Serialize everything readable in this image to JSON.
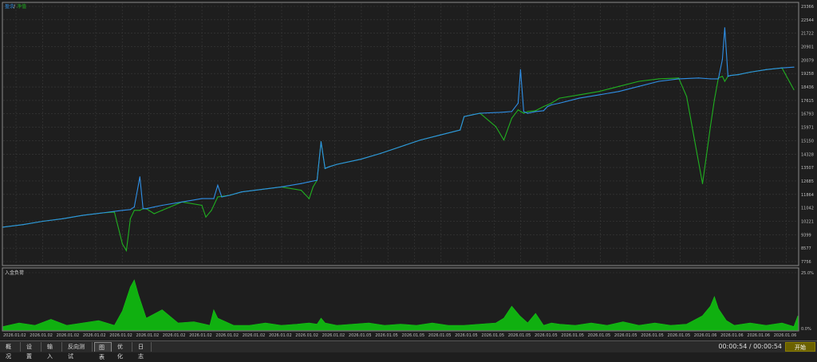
{
  "main_chart": {
    "legend": {
      "series_a": "盈余",
      "separator": "/",
      "series_b": "净值"
    },
    "y_ticks": [
      "23366",
      "22544",
      "21722",
      "20901",
      "20079",
      "19258",
      "18436",
      "17615",
      "16793",
      "15971",
      "15150",
      "14328",
      "13507",
      "12685",
      "11864",
      "11042",
      "10221",
      "9399",
      "8577",
      "7756"
    ],
    "x_ticks": [
      "2026.01.02",
      "2026.01.02",
      "2026.01.02",
      "2026.01.02",
      "2026.01.02",
      "2026.01.02",
      "2026.01.02",
      "2026.01.02",
      "2026.01.02",
      "2026.01.02",
      "2026.01.02",
      "2026.01.02",
      "2026.01.02",
      "2026.01.05",
      "2026.01.05",
      "2026.01.05",
      "2026.01.05",
      "2026.01.05",
      "2026.01.05",
      "2026.01.05",
      "2026.01.05",
      "2026.01.05",
      "2026.01.05",
      "2026.01.05",
      "2026.01.05",
      "2026.01.05",
      "2026.01.06",
      "2026.01.06",
      "2026.01.06",
      "2026.01.06"
    ],
    "colors": {
      "balance": "#2f8fe6",
      "equity": "#20b020",
      "grid": "#3a3a3a",
      "text": "#bfbfbf"
    }
  },
  "sub_chart": {
    "label": "入金负荷",
    "y_ticks": [
      "25.0%",
      "0.0%"
    ],
    "color": "#10b010"
  },
  "chart_data": [
    {
      "type": "line",
      "title": "",
      "ylim": [
        7756,
        23366
      ],
      "series": [
        {
          "name": "盈余",
          "color": "#2f8fe6",
          "x": [
            0,
            25,
            50,
            75,
            100,
            125,
            150,
            160,
            165,
            172,
            176,
            180,
            190,
            200,
            225,
            250,
            265,
            270,
            275,
            285,
            300,
            325,
            350,
            375,
            385,
            395,
            400,
            405,
            410,
            420,
            450,
            475,
            500,
            525,
            550,
            575,
            580,
            590,
            600,
            625,
            640,
            648,
            651,
            655,
            660,
            670,
            680,
            685,
            690,
            700,
            725,
            750,
            775,
            800,
            825,
            850,
            875,
            890,
            900,
            905,
            908,
            912,
            915,
            925,
            940,
            960,
            980,
            995
          ],
          "y": [
            10000,
            10150,
            10350,
            10500,
            10700,
            10850,
            11000,
            11050,
            11200,
            13000,
            11100,
            11100,
            11200,
            11300,
            11500,
            11700,
            11700,
            12500,
            11800,
            11900,
            12100,
            12250,
            12400,
            12600,
            12700,
            12800,
            15100,
            13500,
            13600,
            13750,
            14050,
            14400,
            14800,
            15200,
            15500,
            15800,
            16600,
            16700,
            16800,
            16850,
            16900,
            17400,
            19400,
            16900,
            16800,
            16900,
            16950,
            17200,
            17300,
            17400,
            17700,
            17900,
            18100,
            18400,
            18700,
            18850,
            18900,
            18850,
            18850,
            20000,
            21900,
            19000,
            19050,
            19100,
            19250,
            19400,
            19500,
            19550
          ]
        },
        {
          "name": "净值",
          "color": "#20b020",
          "x": [
            0,
            25,
            50,
            75,
            100,
            125,
            140,
            150,
            155,
            160,
            165,
            172,
            176,
            180,
            190,
            200,
            225,
            250,
            255,
            262,
            270,
            285,
            300,
            325,
            350,
            375,
            385,
            390,
            395,
            400,
            405,
            410,
            420,
            450,
            475,
            500,
            525,
            550,
            575,
            580,
            590,
            600,
            620,
            630,
            640,
            648,
            655,
            660,
            670,
            680,
            685,
            690,
            700,
            725,
            750,
            775,
            800,
            825,
            850,
            860,
            870,
            880,
            885,
            890,
            895,
            900,
            905,
            908,
            912,
            915,
            925,
            940,
            960,
            980,
            995
          ],
          "y": [
            10000,
            10150,
            10350,
            10500,
            10700,
            10850,
            10900,
            9000,
            8600,
            10500,
            11000,
            11000,
            11100,
            11100,
            10800,
            11000,
            11500,
            11300,
            10600,
            11000,
            11800,
            11900,
            12100,
            12250,
            12400,
            12200,
            11700,
            12400,
            12800,
            15100,
            13500,
            13600,
            13750,
            14050,
            14400,
            14800,
            15200,
            15500,
            15800,
            16600,
            16700,
            16800,
            16000,
            15200,
            16500,
            17000,
            16800,
            16900,
            16950,
            17200,
            17300,
            17400,
            17700,
            17900,
            18100,
            18400,
            18700,
            18850,
            18900,
            17800,
            15200,
            12600,
            14300,
            16000,
            17600,
            18900,
            19000,
            18700,
            19000,
            19050,
            19100,
            19250,
            19400,
            19500,
            18200
          ]
        }
      ]
    },
    {
      "type": "area",
      "title": "入金负荷",
      "ylim": [
        0,
        25
      ],
      "series": [
        {
          "name": "入金负荷",
          "x": [
            0,
            20,
            40,
            60,
            80,
            100,
            120,
            140,
            150,
            160,
            165,
            170,
            180,
            200,
            220,
            240,
            260,
            265,
            270,
            290,
            310,
            330,
            350,
            370,
            385,
            395,
            400,
            405,
            420,
            440,
            460,
            480,
            500,
            520,
            540,
            560,
            580,
            600,
            620,
            630,
            640,
            650,
            660,
            670,
            680,
            690,
            700,
            720,
            740,
            760,
            780,
            800,
            820,
            840,
            860,
            880,
            890,
            895,
            900,
            910,
            920,
            940,
            960,
            980,
            995,
            1000
          ],
          "y": [
            1.5,
            3,
            2,
            4.5,
            2,
            3,
            4,
            2,
            8,
            18,
            21,
            15,
            5,
            8.5,
            3,
            3.5,
            2,
            8.5,
            5,
            2,
            2,
            3,
            2,
            2.5,
            3,
            2.5,
            5,
            3,
            2,
            2.5,
            3,
            2,
            2.5,
            2,
            3,
            2,
            2,
            2.5,
            3,
            5,
            10,
            6,
            3,
            7,
            2,
            3,
            2.5,
            2,
            3,
            2,
            3.5,
            2,
            3,
            2,
            2.5,
            6,
            10,
            14,
            9,
            4,
            2,
            3,
            2,
            3,
            1.5,
            6
          ]
        }
      ]
    }
  ],
  "tabs": [
    "概况",
    "设置",
    "输入",
    "反向测试",
    "图表",
    "优化",
    "日志"
  ],
  "active_tab": 4,
  "time_readout": "00:00:54 / 00:00:54",
  "start_button": "开始"
}
